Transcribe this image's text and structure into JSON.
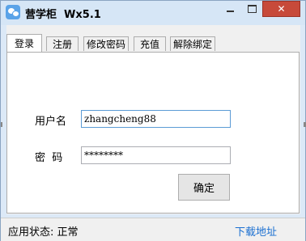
{
  "window": {
    "title": "营学柜  Wx5.1",
    "close_glyph": "✕"
  },
  "tabs": [
    {
      "label": "登录",
      "active": true
    },
    {
      "label": "注册",
      "active": false
    },
    {
      "label": "修改密码",
      "active": false
    },
    {
      "label": "充值",
      "active": false
    },
    {
      "label": "解除绑定",
      "active": false
    }
  ],
  "login": {
    "username_label": "用户名",
    "username_value": "zhangcheng88",
    "password_label": "密  码",
    "password_value": "********",
    "confirm_label": "确定"
  },
  "status_bar": {
    "status_text": "应用状态: 正常",
    "download_link": "下载地址"
  },
  "colors": {
    "close_button": "#c74a3a",
    "link": "#1a6fd1",
    "focus_border": "#5b9bd5"
  }
}
